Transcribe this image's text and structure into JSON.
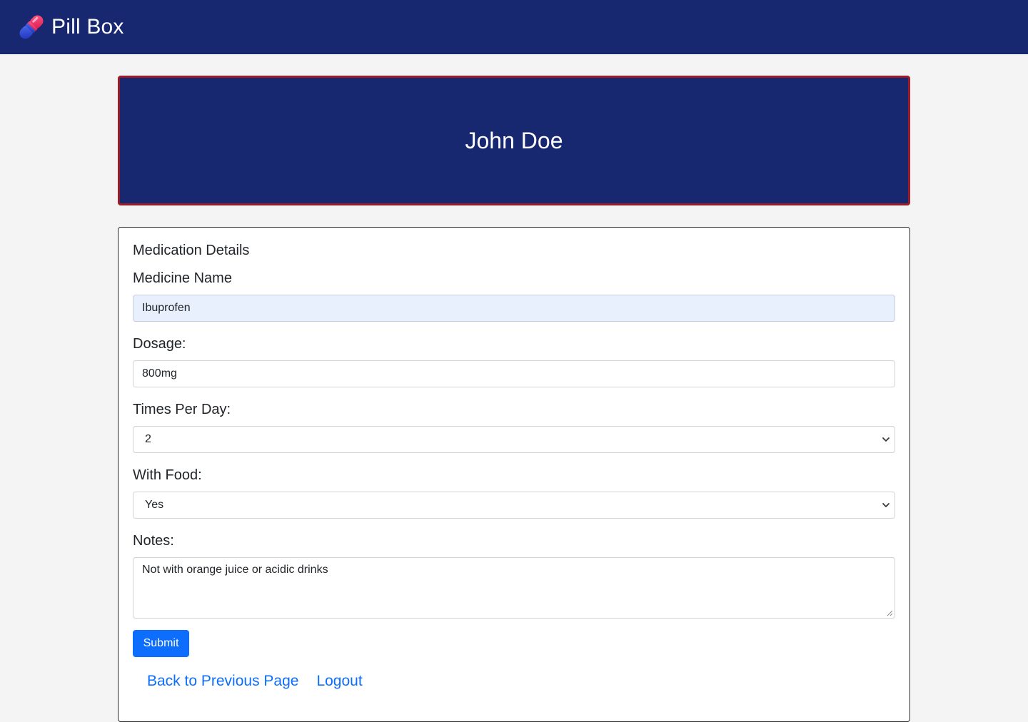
{
  "navbar": {
    "brand": "Pill Box",
    "logo_icon": "pill-capsule-icon"
  },
  "banner": {
    "title": "John Doe"
  },
  "form": {
    "heading": "Medication Details",
    "medicine_name": {
      "label": "Medicine Name",
      "value": "Ibuprofen"
    },
    "dosage": {
      "label": "Dosage:",
      "value": "800mg"
    },
    "times_per_day": {
      "label": "Times Per Day:",
      "selected": "2",
      "icon": "chevron-down-icon"
    },
    "with_food": {
      "label": "With Food:",
      "selected": "Yes",
      "icon": "chevron-down-icon"
    },
    "notes": {
      "label": "Notes:",
      "value": "Not with orange juice or acidic drinks"
    },
    "submit_label": "Submit"
  },
  "links": {
    "back": "Back to Previous Page",
    "logout": "Logout"
  },
  "colors": {
    "navbar_bg": "#172770",
    "banner_border": "#9b1b27",
    "primary": "#0d6efd",
    "page_bg": "#f4f4f4",
    "autofill_bg": "#e8f0fe"
  }
}
